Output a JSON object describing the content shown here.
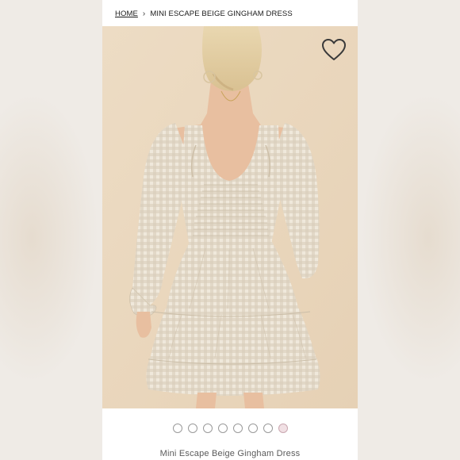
{
  "breadcrumb": {
    "home": "HOME",
    "separator": "›",
    "current": "MINI ESCAPE BEIGE GINGHAM DRESS"
  },
  "product": {
    "title": "Mini Escape Beige Gingham Dress",
    "image_alt_icon": "product-photo",
    "wishlist_icon": "heart-outline-icon"
  },
  "gallery": {
    "dot_count": 8,
    "active_index": 7
  },
  "colors": {
    "background": "#e9d6bd",
    "dress": "#ebe3d4",
    "gingham": "#c9bda8",
    "active_dot": "#f1e0e4"
  }
}
